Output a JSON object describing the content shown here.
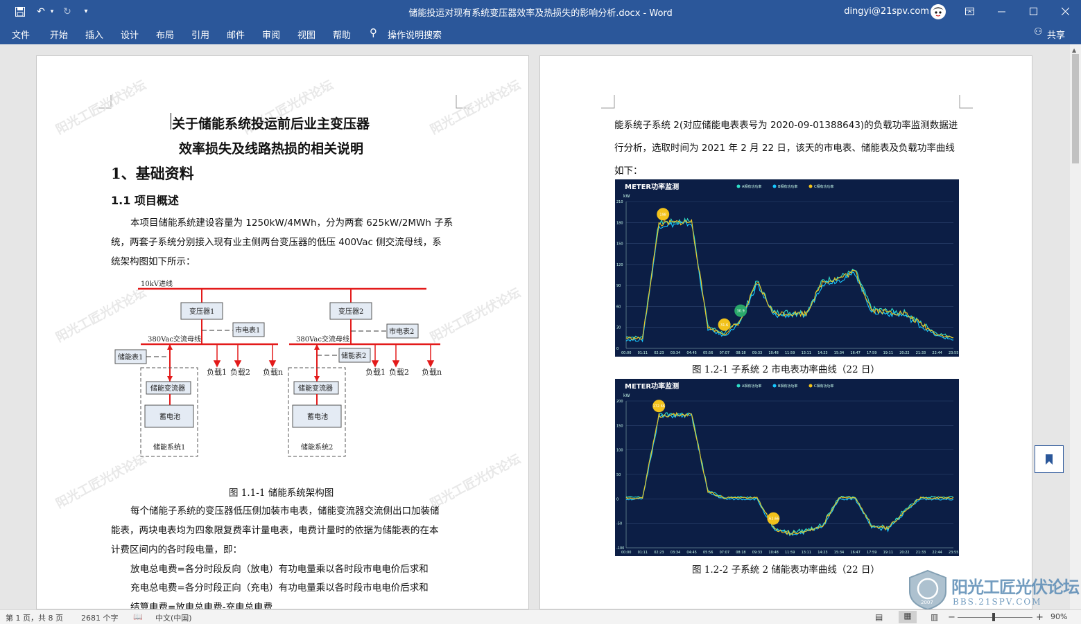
{
  "window": {
    "doc_title": "储能投运对现有系统变压器效率及热损失的影响分析.docx  -  Word",
    "user": "dingyi@21spv.com"
  },
  "ribbon": {
    "tabs": [
      "文件",
      "开始",
      "插入",
      "设计",
      "布局",
      "引用",
      "邮件",
      "审阅",
      "视图",
      "帮助"
    ],
    "tell_me": "操作说明搜索",
    "share": "共享"
  },
  "page1": {
    "title_line1": "关于储能系统投运前后业主变压器",
    "title_line2": "效率损失及线路热损的相关说明",
    "h1": "1、基础资料",
    "h2": "1.1 项目概述",
    "p1_l1": "本项目储能系统建设容量为  1250kW/4MWh，分为两套  625kW/2MWh 子系",
    "p1_l2": "统，两套子系统分别接入现有业主侧两台变压器的低压  400Vac 侧交流母线，系",
    "p1_l3": "统架构图如下所示：",
    "diagram": {
      "bus10kv": "10kV进线",
      "tx1": "变压器1",
      "tx2": "变压器2",
      "meter1": "市电表1",
      "meter2": "市电表2",
      "bus380_1": "380Vac交流母线",
      "bus380_2": "380Vac交流母线",
      "ess_meter1": "储能表1",
      "ess_meter2": "储能表2",
      "pcs": "储能变流器",
      "battery": "蓄电池",
      "sys1": "储能系统1",
      "sys2": "储能系统2",
      "load1": "负载1",
      "load2": "负载2",
      "loadn": "负载n"
    },
    "fig_caption": "图 1.1-1  储能系统架构图",
    "p2_l1": "每个储能子系统的变压器低压侧加装市电表，储能变流器交流侧出口加装储",
    "p2_l2": "能表，两块电表均为四象限复费率计量电表，电费计量时的依据为储能表的在本",
    "p2_l3": "计费区间内的各时段电量，即：",
    "p3": "放电总电费=各分时段反向（放电）有功电量乘以各时段市电电价后求和",
    "p4": "充电总电费=各分时段正向（充电）有功电量乘以各时段市电电价后求和",
    "p5": "结算电费=放电总电费-充电总电费"
  },
  "page2": {
    "p_l1": "能系统子系统  2(对应储能电表表号为  2020-09-01388643)的负载功率监测数据进",
    "p_l2": "行分析，选取时间为  2021 年  2 月  22 日，该天的市电表、储能表及负载功率曲线",
    "p_l3": "如下：",
    "chart1_caption": "图 1.2-1  子系统 2 市电表功率曲线（22 日）",
    "chart2_caption": "图 1.2-2  子系统 2 储能表功率曲线（22 日）"
  },
  "chart_data": [
    {
      "type": "line",
      "title": "METER功率监测",
      "ylabel": "kW",
      "series_names": [
        "A相有功功率",
        "B相有功功率",
        "C相有功功率"
      ],
      "colors": [
        "#2fe0c8",
        "#18c8ff",
        "#f2c21b"
      ],
      "ylim": [
        0,
        210
      ],
      "yticks": [
        0,
        30,
        60,
        90,
        120,
        150,
        180,
        210
      ],
      "x": [
        "00:00",
        "01:11",
        "02:23",
        "03:34",
        "04:45",
        "05:56",
        "07:07",
        "08:18",
        "09:33",
        "10:48",
        "11:59",
        "13:11",
        "14:23",
        "15:34",
        "16:47",
        "17:59",
        "19:11",
        "20:22",
        "21:33",
        "22:44",
        "23:55"
      ],
      "values": [
        15,
        14,
        178,
        180,
        181,
        30,
        20,
        40,
        95,
        50,
        50,
        50,
        95,
        100,
        110,
        55,
        52,
        50,
        35,
        20,
        15
      ],
      "markers": [
        "198",
        "31.6",
        "30.9"
      ]
    },
    {
      "type": "line",
      "title": "METER功率监测",
      "ylabel": "kW",
      "series_names": [
        "A相有功功率",
        "B相有功功率",
        "C相有功功率"
      ],
      "colors": [
        "#2fe0c8",
        "#18c8ff",
        "#f2c21b"
      ],
      "ylim": [
        -100,
        200
      ],
      "yticks": [
        -100,
        -50,
        0,
        50,
        100,
        150,
        200
      ],
      "x": [
        "00:00",
        "01:11",
        "02:23",
        "03:34",
        "04:45",
        "05:56",
        "07:07",
        "08:18",
        "09:33",
        "10:48",
        "11:59",
        "13:11",
        "14:23",
        "15:34",
        "16:47",
        "17:59",
        "19:11",
        "20:22",
        "21:33",
        "22:44",
        "23:55"
      ],
      "values": [
        2,
        2,
        170,
        172,
        172,
        15,
        2,
        2,
        2,
        -60,
        -70,
        -65,
        -55,
        2,
        2,
        -55,
        -60,
        -25,
        2,
        2,
        2
      ],
      "markers": [
        "172.66",
        "-62.66"
      ]
    }
  ],
  "status": {
    "page": "第 1 页，共 8 页",
    "words": "2681 个字",
    "lang": "中文(中国)",
    "zoom": "90%"
  },
  "watermark": {
    "line1": "阳光工匠光伏论坛",
    "line2": "BBS.21SPV.COM",
    "year": "2007"
  }
}
